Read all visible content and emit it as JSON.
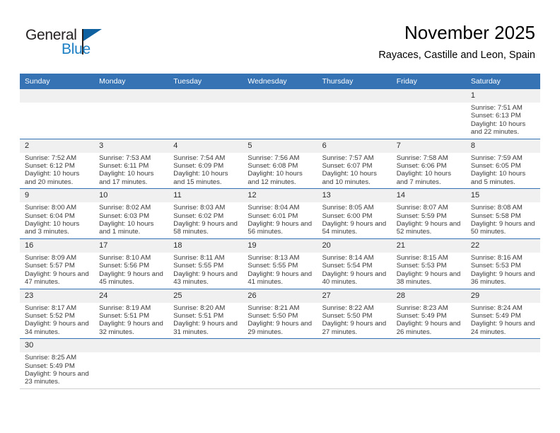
{
  "brand": {
    "name_top": "General",
    "name_bottom": "Blue",
    "color_dark": "#231f20",
    "color_blue": "#1c7fc4",
    "flag_color": "#10619f"
  },
  "header": {
    "title": "November 2025",
    "subtitle": "Rayaces, Castille and Leon, Spain"
  },
  "theme": {
    "header_bg": "#3573b4",
    "daynum_bg": "#f0f0f0",
    "row_rule": "#3573b4"
  },
  "weekdays": [
    "Sunday",
    "Monday",
    "Tuesday",
    "Wednesday",
    "Thursday",
    "Friday",
    "Saturday"
  ],
  "weeks": [
    [
      {
        "day": "",
        "sunrise": "",
        "sunset": "",
        "daylight": ""
      },
      {
        "day": "",
        "sunrise": "",
        "sunset": "",
        "daylight": ""
      },
      {
        "day": "",
        "sunrise": "",
        "sunset": "",
        "daylight": ""
      },
      {
        "day": "",
        "sunrise": "",
        "sunset": "",
        "daylight": ""
      },
      {
        "day": "",
        "sunrise": "",
        "sunset": "",
        "daylight": ""
      },
      {
        "day": "",
        "sunrise": "",
        "sunset": "",
        "daylight": ""
      },
      {
        "day": "1",
        "sunrise": "Sunrise: 7:51 AM",
        "sunset": "Sunset: 6:13 PM",
        "daylight": "Daylight: 10 hours and 22 minutes."
      }
    ],
    [
      {
        "day": "2",
        "sunrise": "Sunrise: 7:52 AM",
        "sunset": "Sunset: 6:12 PM",
        "daylight": "Daylight: 10 hours and 20 minutes."
      },
      {
        "day": "3",
        "sunrise": "Sunrise: 7:53 AM",
        "sunset": "Sunset: 6:11 PM",
        "daylight": "Daylight: 10 hours and 17 minutes."
      },
      {
        "day": "4",
        "sunrise": "Sunrise: 7:54 AM",
        "sunset": "Sunset: 6:09 PM",
        "daylight": "Daylight: 10 hours and 15 minutes."
      },
      {
        "day": "5",
        "sunrise": "Sunrise: 7:56 AM",
        "sunset": "Sunset: 6:08 PM",
        "daylight": "Daylight: 10 hours and 12 minutes."
      },
      {
        "day": "6",
        "sunrise": "Sunrise: 7:57 AM",
        "sunset": "Sunset: 6:07 PM",
        "daylight": "Daylight: 10 hours and 10 minutes."
      },
      {
        "day": "7",
        "sunrise": "Sunrise: 7:58 AM",
        "sunset": "Sunset: 6:06 PM",
        "daylight": "Daylight: 10 hours and 7 minutes."
      },
      {
        "day": "8",
        "sunrise": "Sunrise: 7:59 AM",
        "sunset": "Sunset: 6:05 PM",
        "daylight": "Daylight: 10 hours and 5 minutes."
      }
    ],
    [
      {
        "day": "9",
        "sunrise": "Sunrise: 8:00 AM",
        "sunset": "Sunset: 6:04 PM",
        "daylight": "Daylight: 10 hours and 3 minutes."
      },
      {
        "day": "10",
        "sunrise": "Sunrise: 8:02 AM",
        "sunset": "Sunset: 6:03 PM",
        "daylight": "Daylight: 10 hours and 1 minute."
      },
      {
        "day": "11",
        "sunrise": "Sunrise: 8:03 AM",
        "sunset": "Sunset: 6:02 PM",
        "daylight": "Daylight: 9 hours and 58 minutes."
      },
      {
        "day": "12",
        "sunrise": "Sunrise: 8:04 AM",
        "sunset": "Sunset: 6:01 PM",
        "daylight": "Daylight: 9 hours and 56 minutes."
      },
      {
        "day": "13",
        "sunrise": "Sunrise: 8:05 AM",
        "sunset": "Sunset: 6:00 PM",
        "daylight": "Daylight: 9 hours and 54 minutes."
      },
      {
        "day": "14",
        "sunrise": "Sunrise: 8:07 AM",
        "sunset": "Sunset: 5:59 PM",
        "daylight": "Daylight: 9 hours and 52 minutes."
      },
      {
        "day": "15",
        "sunrise": "Sunrise: 8:08 AM",
        "sunset": "Sunset: 5:58 PM",
        "daylight": "Daylight: 9 hours and 50 minutes."
      }
    ],
    [
      {
        "day": "16",
        "sunrise": "Sunrise: 8:09 AM",
        "sunset": "Sunset: 5:57 PM",
        "daylight": "Daylight: 9 hours and 47 minutes."
      },
      {
        "day": "17",
        "sunrise": "Sunrise: 8:10 AM",
        "sunset": "Sunset: 5:56 PM",
        "daylight": "Daylight: 9 hours and 45 minutes."
      },
      {
        "day": "18",
        "sunrise": "Sunrise: 8:11 AM",
        "sunset": "Sunset: 5:55 PM",
        "daylight": "Daylight: 9 hours and 43 minutes."
      },
      {
        "day": "19",
        "sunrise": "Sunrise: 8:13 AM",
        "sunset": "Sunset: 5:55 PM",
        "daylight": "Daylight: 9 hours and 41 minutes."
      },
      {
        "day": "20",
        "sunrise": "Sunrise: 8:14 AM",
        "sunset": "Sunset: 5:54 PM",
        "daylight": "Daylight: 9 hours and 40 minutes."
      },
      {
        "day": "21",
        "sunrise": "Sunrise: 8:15 AM",
        "sunset": "Sunset: 5:53 PM",
        "daylight": "Daylight: 9 hours and 38 minutes."
      },
      {
        "day": "22",
        "sunrise": "Sunrise: 8:16 AM",
        "sunset": "Sunset: 5:53 PM",
        "daylight": "Daylight: 9 hours and 36 minutes."
      }
    ],
    [
      {
        "day": "23",
        "sunrise": "Sunrise: 8:17 AM",
        "sunset": "Sunset: 5:52 PM",
        "daylight": "Daylight: 9 hours and 34 minutes."
      },
      {
        "day": "24",
        "sunrise": "Sunrise: 8:19 AM",
        "sunset": "Sunset: 5:51 PM",
        "daylight": "Daylight: 9 hours and 32 minutes."
      },
      {
        "day": "25",
        "sunrise": "Sunrise: 8:20 AM",
        "sunset": "Sunset: 5:51 PM",
        "daylight": "Daylight: 9 hours and 31 minutes."
      },
      {
        "day": "26",
        "sunrise": "Sunrise: 8:21 AM",
        "sunset": "Sunset: 5:50 PM",
        "daylight": "Daylight: 9 hours and 29 minutes."
      },
      {
        "day": "27",
        "sunrise": "Sunrise: 8:22 AM",
        "sunset": "Sunset: 5:50 PM",
        "daylight": "Daylight: 9 hours and 27 minutes."
      },
      {
        "day": "28",
        "sunrise": "Sunrise: 8:23 AM",
        "sunset": "Sunset: 5:49 PM",
        "daylight": "Daylight: 9 hours and 26 minutes."
      },
      {
        "day": "29",
        "sunrise": "Sunrise: 8:24 AM",
        "sunset": "Sunset: 5:49 PM",
        "daylight": "Daylight: 9 hours and 24 minutes."
      }
    ],
    [
      {
        "day": "30",
        "sunrise": "Sunrise: 8:25 AM",
        "sunset": "Sunset: 5:49 PM",
        "daylight": "Daylight: 9 hours and 23 minutes."
      },
      {
        "day": "",
        "sunrise": "",
        "sunset": "",
        "daylight": ""
      },
      {
        "day": "",
        "sunrise": "",
        "sunset": "",
        "daylight": ""
      },
      {
        "day": "",
        "sunrise": "",
        "sunset": "",
        "daylight": ""
      },
      {
        "day": "",
        "sunrise": "",
        "sunset": "",
        "daylight": ""
      },
      {
        "day": "",
        "sunrise": "",
        "sunset": "",
        "daylight": ""
      },
      {
        "day": "",
        "sunrise": "",
        "sunset": "",
        "daylight": ""
      }
    ]
  ]
}
